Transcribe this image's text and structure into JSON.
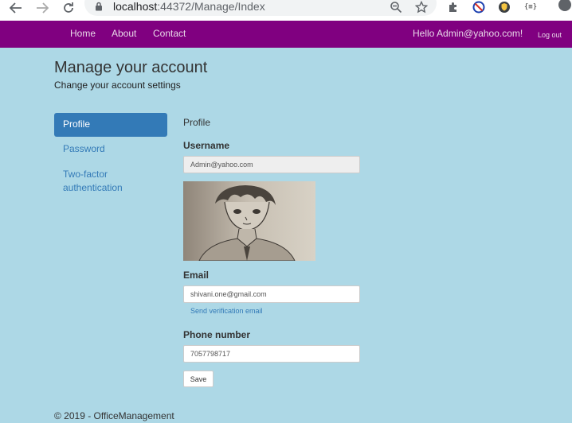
{
  "browser": {
    "url_host": "localhost",
    "url_port_path": ":44372/Manage/Index",
    "icons": [
      "back-icon",
      "forward-icon",
      "reload-icon",
      "lock-icon",
      "zoom-icon",
      "star-icon",
      "extensions-icon",
      "blocked-icon",
      "shield-icon",
      "json-icon"
    ],
    "ext_json_label": "{≡}"
  },
  "navbar": {
    "home": "Home",
    "about": "About",
    "contact": "Contact",
    "greeting": "Hello Admin@yahoo.com!",
    "logout": "Log out",
    "color": "#800080"
  },
  "page": {
    "title": "Manage your account",
    "subtitle": "Change your account settings"
  },
  "sidebar": {
    "items": [
      {
        "label": "Profile",
        "active": true
      },
      {
        "label": "Password",
        "active": false
      },
      {
        "label": "Two-factor",
        "active": false
      },
      {
        "label": "authentication",
        "active": false
      }
    ],
    "active_color": "#337ab7"
  },
  "form": {
    "section": "Profile",
    "username_label": "Username",
    "username_value": "Admin@yahoo.com",
    "email_label": "Email",
    "email_value": "shivani.one@gmail.com",
    "send_verification": "Send verification email",
    "phone_label": "Phone number",
    "phone_value": "7057798717",
    "save": "Save"
  },
  "footer": {
    "text": "© 2019 - OfficeManagement"
  }
}
